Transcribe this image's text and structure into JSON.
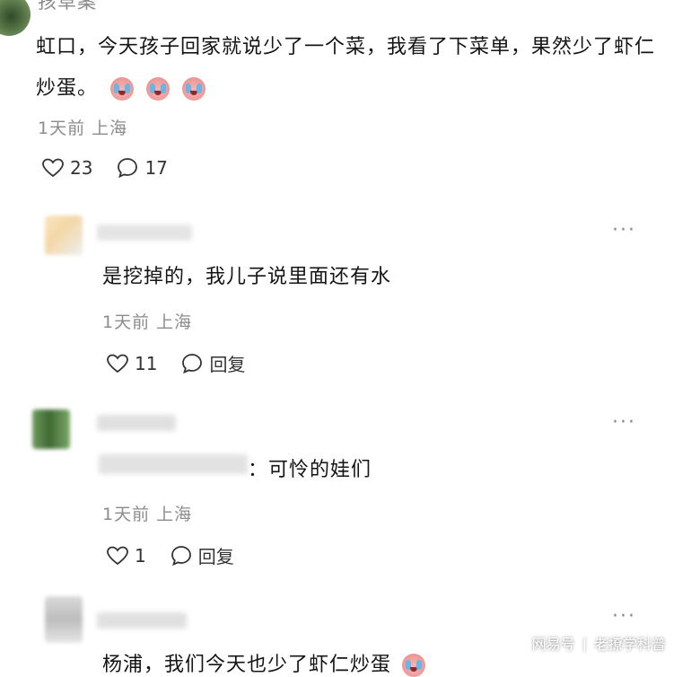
{
  "main_comment": {
    "cut_username": "孩草案",
    "text": "虹口，今天孩子回家就说少了一个菜，我看了下菜单，果然少了虾仁炒蛋。",
    "emoji_icons": [
      "crying-face-icon",
      "crying-face-icon",
      "crying-face-icon"
    ],
    "meta": "1天前 上海",
    "likes": "23",
    "comments": "17"
  },
  "replies": [
    {
      "text": "是挖掉的，我儿子说里面还有水",
      "meta": "1天前 上海",
      "likes": "11",
      "reply_label": "回复"
    },
    {
      "text": "：可怜的娃们",
      "meta": "1天前 上海",
      "likes": "1",
      "reply_label": "回复"
    },
    {
      "text": "杨浦，我们今天也少了虾仁炒蛋"
    }
  ],
  "more_label": "···",
  "watermark": {
    "source": "网易号",
    "author": "老撩学科普"
  },
  "colors": {
    "text": "#141414",
    "meta": "#8c8c8c",
    "icon": "#333333",
    "background": "#ffffff"
  }
}
